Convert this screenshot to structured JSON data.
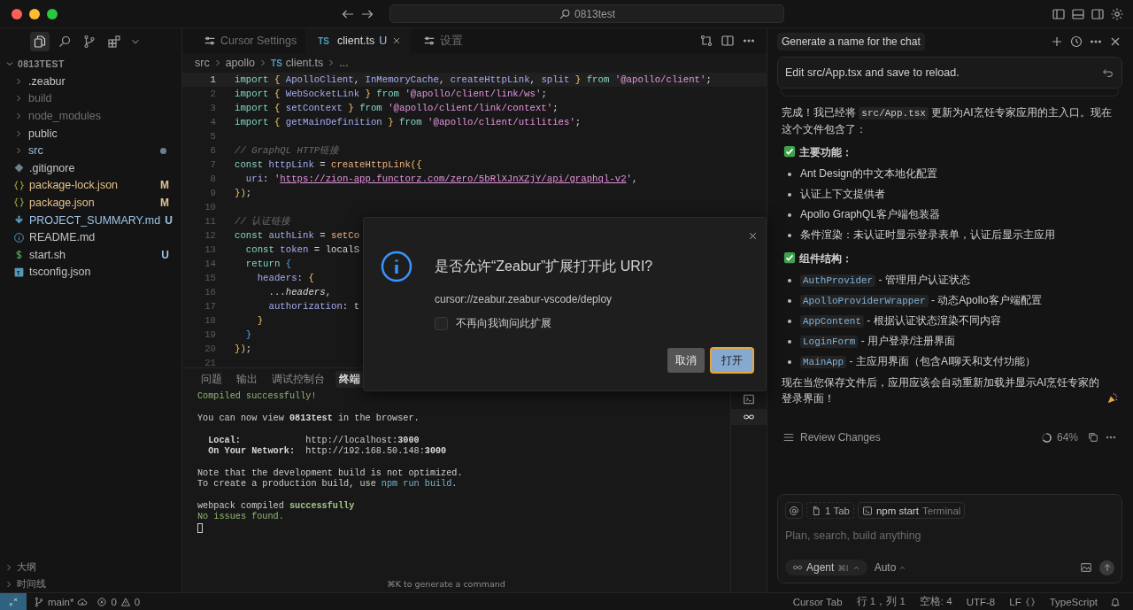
{
  "titlebar": {
    "search": "0813test"
  },
  "activity": [
    {
      "kind": "files",
      "selected": true
    },
    {
      "kind": "search",
      "selected": false
    },
    {
      "kind": "scm",
      "selected": false
    },
    {
      "kind": "extensions",
      "selected": false
    }
  ],
  "explorer": {
    "label": "0813TEST",
    "expanded": true,
    "children": [
      {
        "name": ".zeabur",
        "kind": "folder",
        "expanded": false,
        "ignored": false,
        "modified": false,
        "untracked": false
      },
      {
        "name": "build",
        "kind": "folder",
        "expanded": false,
        "ignored": true,
        "modified": false,
        "untracked": false
      },
      {
        "name": "node_modules",
        "kind": "folder",
        "expanded": false,
        "ignored": true,
        "modified": false,
        "untracked": false
      },
      {
        "name": "public",
        "kind": "folder",
        "expanded": false,
        "ignored": false,
        "modified": false,
        "untracked": false
      },
      {
        "name": "src",
        "kind": "folder",
        "expanded": false,
        "ignored": false,
        "modified": false,
        "untracked": true,
        "has_changes": true
      },
      {
        "name": ".gitignore",
        "kind": "git",
        "ignored": false,
        "modified": false,
        "untracked": false
      },
      {
        "name": "package-lock.json",
        "kind": "json",
        "ignored": false,
        "modified": true,
        "untracked": false,
        "badge": "M"
      },
      {
        "name": "package.json",
        "kind": "json",
        "ignored": false,
        "modified": true,
        "untracked": false,
        "badge": "M"
      },
      {
        "name": "PROJECT_SUMMARY.md",
        "kind": "md",
        "ignored": false,
        "modified": false,
        "untracked": true,
        "badge": "U"
      },
      {
        "name": "README.md",
        "kind": "readme",
        "ignored": false,
        "modified": false,
        "untracked": false
      },
      {
        "name": "start.sh",
        "kind": "shell",
        "ignored": false,
        "modified": false,
        "untracked": false,
        "badge": "U"
      },
      {
        "name": "tsconfig.json",
        "kind": "ts",
        "ignored": false,
        "modified": false,
        "untracked": false
      }
    ]
  },
  "sections": [
    {
      "label": "大纲",
      "expanded": false
    },
    {
      "label": "时间线",
      "expanded": false
    }
  ],
  "tabs": [
    {
      "label": "Cursor Settings",
      "kind": "settings",
      "selected": false
    },
    {
      "label": "client.ts",
      "kind": "ts",
      "badge": "TS",
      "status": "U",
      "selected": true
    },
    {
      "label": "设置",
      "kind": "settings",
      "selected": false
    }
  ],
  "breadcrumb": [
    {
      "label": "src"
    },
    {
      "label": "apollo"
    },
    {
      "label": "client.ts",
      "badge": "TS"
    },
    {
      "label": "..."
    }
  ],
  "editor": {
    "lines": [
      {
        "number": "1",
        "active": true,
        "tokens": [
          {
            "text": "import ",
            "kind": "kw"
          },
          {
            "text": "{ ",
            "kind": "p"
          },
          {
            "text": "ApolloClient",
            "kind": "id"
          },
          {
            "text": ", ",
            "kind": "n"
          },
          {
            "text": "InMemoryCache",
            "kind": "id"
          },
          {
            "text": ", ",
            "kind": "n"
          },
          {
            "text": "createHttpLink",
            "kind": "id"
          },
          {
            "text": ", ",
            "kind": "n"
          },
          {
            "text": "split ",
            "kind": "id"
          },
          {
            "text": "} ",
            "kind": "p"
          },
          {
            "text": "from ",
            "kind": "kw"
          },
          {
            "text": "'@apollo/client'",
            "kind": "s"
          },
          {
            "text": ";",
            "kind": "n"
          }
        ]
      },
      {
        "number": "2",
        "active": false,
        "tokens": [
          {
            "text": "import ",
            "kind": "kw"
          },
          {
            "text": "{ ",
            "kind": "p"
          },
          {
            "text": "WebSocketLink ",
            "kind": "id"
          },
          {
            "text": "} ",
            "kind": "p"
          },
          {
            "text": "from ",
            "kind": "kw"
          },
          {
            "text": "'@apollo/client/link/ws'",
            "kind": "s"
          },
          {
            "text": ";",
            "kind": "n"
          }
        ]
      },
      {
        "number": "3",
        "active": false,
        "tokens": [
          {
            "text": "import ",
            "kind": "kw"
          },
          {
            "text": "{ ",
            "kind": "p"
          },
          {
            "text": "setContext ",
            "kind": "id"
          },
          {
            "text": "} ",
            "kind": "p"
          },
          {
            "text": "from ",
            "kind": "kw"
          },
          {
            "text": "'@apollo/client/link/context'",
            "kind": "s"
          },
          {
            "text": ";",
            "kind": "n"
          }
        ]
      },
      {
        "number": "4",
        "active": false,
        "tokens": [
          {
            "text": "import ",
            "kind": "kw"
          },
          {
            "text": "{ ",
            "kind": "p"
          },
          {
            "text": "getMainDefinition ",
            "kind": "id"
          },
          {
            "text": "} ",
            "kind": "p"
          },
          {
            "text": "from ",
            "kind": "kw"
          },
          {
            "text": "'@apollo/client/utilities'",
            "kind": "s"
          },
          {
            "text": ";",
            "kind": "n"
          }
        ]
      },
      {
        "number": "5",
        "active": false
      },
      {
        "number": "6",
        "active": false,
        "tokens": [
          {
            "text": "// GraphQL HTTP链接",
            "kind": "c"
          }
        ]
      },
      {
        "number": "7",
        "active": false,
        "tokens": [
          {
            "text": "const ",
            "kind": "kw"
          },
          {
            "text": "httpLink",
            "kind": "id"
          },
          {
            "text": " = ",
            "kind": "n"
          },
          {
            "text": "createHttpLink",
            "kind": "f"
          },
          {
            "text": "({",
            "kind": "p"
          }
        ]
      },
      {
        "number": "8",
        "active": false,
        "tokens": [
          {
            "text": "  uri",
            "kind": "id"
          },
          {
            "text": ": ",
            "kind": "n"
          },
          {
            "text": "'",
            "kind": "s"
          },
          {
            "text": "https://zion-app.functorz.com/zero/5bRlXJnXZjY/api/graphql-v2",
            "kind": "u"
          },
          {
            "text": "'",
            "kind": "s"
          },
          {
            "text": ",",
            "kind": "n"
          }
        ]
      },
      {
        "number": "9",
        "active": false,
        "tokens": [
          {
            "text": "})",
            "kind": "p"
          },
          {
            "text": ";",
            "kind": "n"
          }
        ]
      },
      {
        "number": "10",
        "active": false
      },
      {
        "number": "11",
        "active": false,
        "tokens": [
          {
            "text": "// 认证链接",
            "kind": "c"
          }
        ]
      },
      {
        "number": "12",
        "active": false,
        "tokens": [
          {
            "text": "const ",
            "kind": "kw"
          },
          {
            "text": "authLink",
            "kind": "id"
          },
          {
            "text": " = ",
            "kind": "n"
          },
          {
            "text": "setCo",
            "kind": "f"
          }
        ]
      },
      {
        "number": "13",
        "active": false,
        "tokens": [
          {
            "text": "  const ",
            "kind": "kw"
          },
          {
            "text": "token",
            "kind": "id"
          },
          {
            "text": " = localS",
            "kind": "n"
          }
        ]
      },
      {
        "number": "14",
        "active": false,
        "tokens": [
          {
            "text": "  return ",
            "kind": "kw"
          },
          {
            "text": "{",
            "kind": "p2"
          }
        ]
      },
      {
        "number": "15",
        "active": false,
        "tokens": [
          {
            "text": "    headers",
            "kind": "id"
          },
          {
            "text": ": ",
            "kind": "n"
          },
          {
            "text": "{",
            "kind": "p"
          }
        ]
      },
      {
        "number": "16",
        "active": false,
        "tokens": [
          {
            "text": "      ...",
            "kind": "n"
          },
          {
            "text": "headers",
            "kind": "it"
          },
          {
            "text": ",",
            "kind": "n"
          }
        ]
      },
      {
        "number": "17",
        "active": false,
        "tokens": [
          {
            "text": "      authorization",
            "kind": "id"
          },
          {
            "text": ": t",
            "kind": "n"
          }
        ]
      },
      {
        "number": "18",
        "active": false,
        "tokens": [
          {
            "text": "    }",
            "kind": "p"
          }
        ]
      },
      {
        "number": "19",
        "active": false,
        "tokens": [
          {
            "text": "  }",
            "kind": "p2"
          }
        ]
      },
      {
        "number": "20",
        "active": false,
        "tokens": [
          {
            "text": "})",
            "kind": "p"
          },
          {
            "text": ";",
            "kind": "n"
          }
        ]
      },
      {
        "number": "21",
        "active": false
      }
    ]
  },
  "panel": {
    "tabs": [
      {
        "label": "问题",
        "selected": false
      },
      {
        "label": "输出",
        "selected": false
      },
      {
        "label": "调试控制台",
        "selected": false
      },
      {
        "label": "终端",
        "selected": true
      }
    ],
    "blocks": [
      [
        [
          {
            "text": "Compiled successfully!",
            "kind": "green"
          }
        ]
      ],
      [
        [
          {
            "text": "You can now view ",
            "kind": "plain"
          },
          {
            "text": "0813test",
            "kind": "bold"
          },
          {
            "text": " in the browser.",
            "kind": "plain"
          }
        ]
      ],
      [
        [
          {
            "text": "  Local:",
            "kind": "bold"
          },
          {
            "text": "            http://localhost:",
            "kind": "plain"
          },
          {
            "text": "3000",
            "kind": "bold"
          }
        ],
        [
          {
            "text": "  On Your Network:",
            "kind": "bold"
          },
          {
            "text": "  http://192.168.50.148:",
            "kind": "plain"
          },
          {
            "text": "3000",
            "kind": "bold"
          }
        ]
      ],
      [
        [
          {
            "text": "Note that the development build is not optimized.",
            "kind": "plain"
          }
        ],
        [
          {
            "text": "To create a production build, use ",
            "kind": "plain"
          },
          {
            "text": "npm run build",
            "kind": "blue"
          },
          {
            "text": ".",
            "kind": "plain"
          }
        ]
      ],
      [
        [
          {
            "text": "webpack compiled ",
            "kind": "plain"
          },
          {
            "text": "successfully",
            "kind": "boldgreen"
          }
        ],
        [
          {
            "text": "No issues found.",
            "kind": "green"
          }
        ]
      ]
    ],
    "cursor": true,
    "hint": "⌘K to generate a command",
    "terminals": [
      {
        "kind": "shell",
        "selected": false
      },
      {
        "kind": "agent",
        "selected": true
      }
    ]
  },
  "chat": {
    "title": "Generate a name for the chat",
    "prompt": "Edit src/App.tsx and save to reload.",
    "message": [
      {
        "kind": "paragraph",
        "parts": [
          {
            "kind": "text",
            "text": "完成！我已经将 "
          },
          {
            "kind": "code",
            "text": "src/App.tsx"
          },
          {
            "kind": "text",
            "text": " 更新为AI烹饪专家应用的主入口。现在这个文件包含了："
          }
        ]
      },
      {
        "kind": "heading",
        "text": "主要功能："
      },
      {
        "kind": "list",
        "items": [
          [
            {
              "kind": "text",
              "text": "Ant Design的中文本地化配置"
            }
          ],
          [
            {
              "kind": "text",
              "text": "认证上下文提供者"
            }
          ],
          [
            {
              "kind": "text",
              "text": "Apollo GraphQL客户端包装器"
            }
          ],
          [
            {
              "kind": "text",
              "text": "条件渲染：未认证时显示登录表单，认证后显示主应用"
            }
          ]
        ]
      },
      {
        "kind": "heading",
        "text": "组件结构："
      },
      {
        "kind": "list",
        "items": [
          [
            {
              "kind": "symbol",
              "text": "AuthProvider"
            },
            {
              "kind": "text",
              "text": " - 管理用户认证状态"
            }
          ],
          [
            {
              "kind": "symbol",
              "text": "ApolloProviderWrapper"
            },
            {
              "kind": "text",
              "text": " - 动态Apollo客户端配置"
            }
          ],
          [
            {
              "kind": "symbol",
              "text": "AppContent"
            },
            {
              "kind": "text",
              "text": " - 根据认证状态渲染不同内容"
            }
          ],
          [
            {
              "kind": "symbol",
              "text": "LoginForm"
            },
            {
              "kind": "text",
              "text": " - 用户登录/注册界面"
            }
          ],
          [
            {
              "kind": "symbol",
              "text": "MainApp"
            },
            {
              "kind": "text",
              "text": " - 主应用界面（包含AI聊天和支付功能）"
            }
          ]
        ]
      },
      {
        "kind": "paragraph",
        "parts": [
          {
            "kind": "text",
            "text": "现在当您保存文件后，应用应该会自动重新加载并显示AI烹饪专家的登录界面！"
          }
        ]
      }
    ],
    "review": {
      "label": "Review Changes",
      "usage": "64%"
    },
    "composer": {
      "context": [
        {
          "kind": "tab",
          "label": "1 Tab"
        },
        {
          "kind": "terminal",
          "label": "npm start",
          "sublabel": "Terminal"
        }
      ],
      "placeholder": "Plan, search, build anything",
      "mode": "Agent",
      "shortcut": "⌘I",
      "model": "Auto"
    }
  },
  "statusbar": {
    "branch": "main*",
    "errors": "0",
    "warnings": "0",
    "items": [
      {
        "label": "Cursor Tab",
        "kind": "text"
      },
      {
        "label": "行 1，列 1",
        "kind": "text"
      },
      {
        "label": "空格: 4",
        "kind": "text"
      },
      {
        "label": "UTF-8",
        "kind": "text"
      },
      {
        "label": "LF",
        "kind": "text"
      },
      {
        "label": "TypeScript",
        "kind": "language"
      }
    ]
  },
  "dialog": {
    "title": "是否允许“Zeabur”扩展打开此 URI?",
    "detail": "cursor://zeabur.zeabur-vscode/deploy",
    "checkbox": {
      "label": "不再向我询问此扩展",
      "checked": false
    },
    "buttons": [
      {
        "label": "取消",
        "primary": false
      },
      {
        "label": "打开",
        "primary": true
      }
    ]
  }
}
